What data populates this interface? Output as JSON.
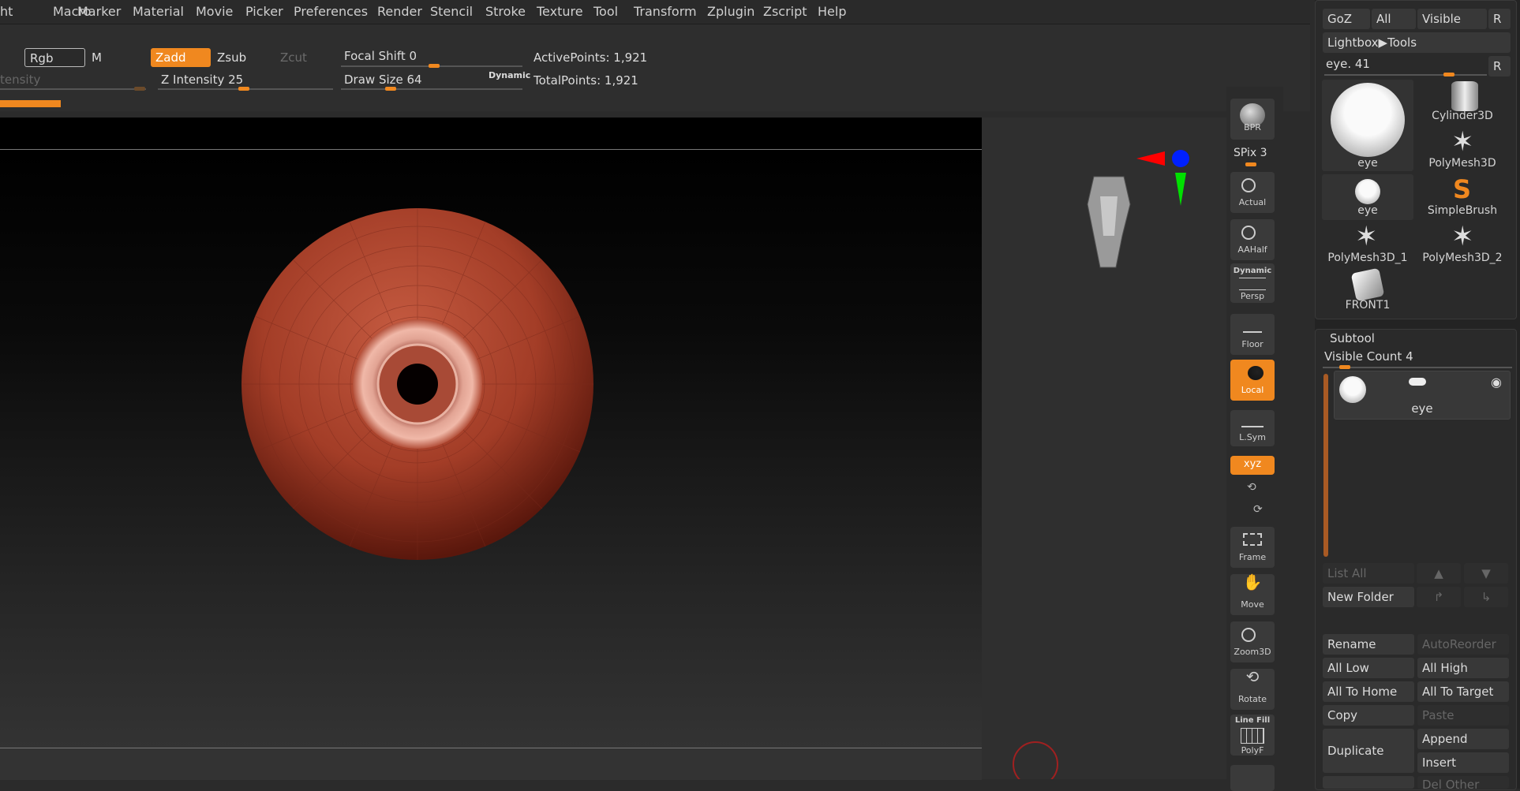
{
  "menu": [
    "ht",
    "Macro",
    "Marker",
    "Material",
    "Movie",
    "Picker",
    "Preferences",
    "Render",
    "Stencil",
    "Stroke",
    "Texture",
    "Tool",
    "Transform",
    "Zplugin",
    "Zscript",
    "Help"
  ],
  "shelf": {
    "rgb": "Rgb",
    "m": "M",
    "zadd": "Zadd",
    "zsub": "Zsub",
    "zcut": "Zcut",
    "intensity_label": "tensity",
    "z_intensity": "Z Intensity 25",
    "focal_shift": "Focal Shift 0",
    "draw_size": "Draw Size 64",
    "dynamic": "Dynamic",
    "active_points": "ActivePoints: 1,921",
    "total_points": "TotalPoints: 1,921",
    "z_intensity_value": 25,
    "focal_shift_value": 0,
    "draw_size_value": 64
  },
  "toolbar": {
    "bpr": "BPR",
    "spix": "SPix 3",
    "actual": "Actual",
    "aahalf": "AAHalf",
    "dynamic": "Dynamic",
    "persp": "Persp",
    "floor": "Floor",
    "local": "Local",
    "lsym": "L.Sym",
    "xyz": "xyz",
    "frame": "Frame",
    "move": "Move",
    "zoom3d": "Zoom3D",
    "rotate": "Rotate",
    "linefill": "Line Fill",
    "polyf": "PolyF"
  },
  "tool_panel": {
    "goz": "GoZ",
    "all": "All",
    "visible": "Visible",
    "r": "R",
    "lightbox_tools": "Lightbox▶Tools",
    "current_tool": "eye. 41",
    "current_tool_value": 41,
    "tiles": [
      "eye",
      "Cylinder3D",
      "PolyMesh3D",
      "eye",
      "SimpleBrush",
      "PolyMesh3D_1",
      "PolyMesh3D_2",
      "FRONT1"
    ]
  },
  "subtool": {
    "title": "Subtool",
    "visible_count": "Visible Count 4",
    "item_name": "eye",
    "list_all": "List All",
    "new_folder": "New Folder",
    "rename": "Rename",
    "auto_reorder": "AutoReorder",
    "all_low": "All Low",
    "all_high": "All High",
    "all_to_home": "All To Home",
    "all_to_target": "All To Target",
    "copy": "Copy",
    "paste": "Paste",
    "duplicate": "Duplicate",
    "append": "Append",
    "insert": "Insert",
    "del_other": "Del Other"
  },
  "colors": {
    "accent": "#f0881f",
    "mesh": "#a8412a"
  }
}
